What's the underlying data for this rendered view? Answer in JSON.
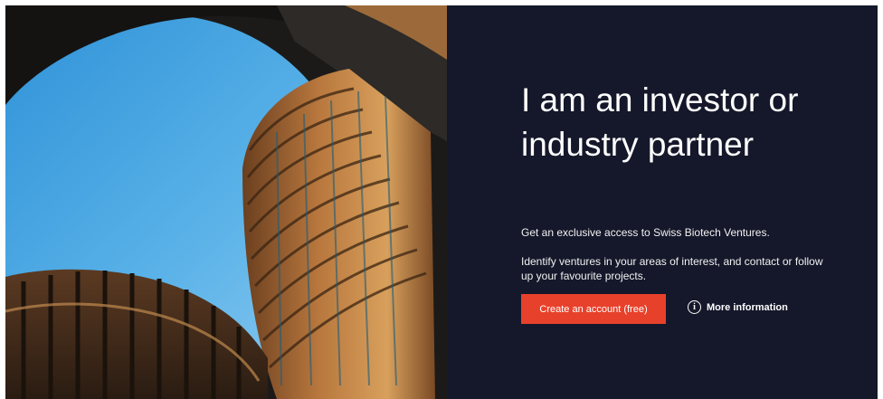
{
  "hero": {
    "image": "modern-circular-building-photo",
    "title": "I am an investor or industry partner",
    "paragraph_1": "Get an exclusive access to Swiss Biotech Ventures.",
    "paragraph_2": "Identify ventures in your areas of interest, and contact or follow up your favourite projects.",
    "cta_label": "Create an account (free)",
    "more_info_label": "More information",
    "info_icon": "info-circle-icon"
  },
  "colors": {
    "panel_bg": "#15182a",
    "accent": "#e8412b",
    "text": "#ffffff"
  }
}
